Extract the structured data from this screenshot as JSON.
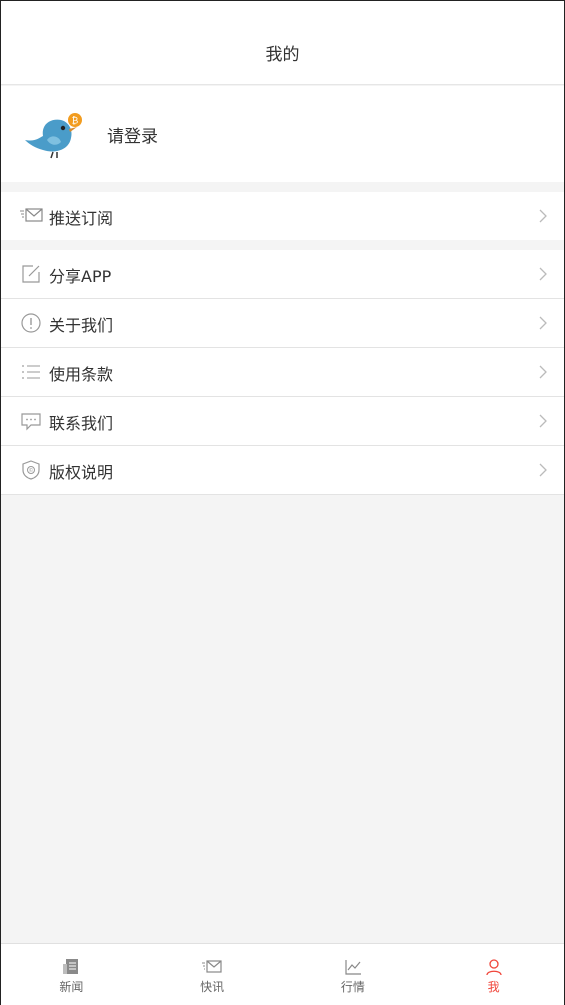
{
  "header": {
    "title": "我的"
  },
  "profile": {
    "login_label": "请登录"
  },
  "menu": {
    "push": {
      "label": "推送订阅",
      "icon": "envelope-icon"
    },
    "share": {
      "label": "分享APP",
      "icon": "share-icon"
    },
    "about": {
      "label": "关于我们",
      "icon": "info-icon"
    },
    "terms": {
      "label": "使用条款",
      "icon": "list-icon"
    },
    "contact": {
      "label": "联系我们",
      "icon": "chat-icon"
    },
    "copyright": {
      "label": "版权说明",
      "icon": "shield-icon"
    }
  },
  "tabbar": {
    "tabs": [
      {
        "label": "新闻",
        "icon": "news-icon",
        "active": false
      },
      {
        "label": "快讯",
        "icon": "envelope-icon",
        "active": false
      },
      {
        "label": "行情",
        "icon": "chart-icon",
        "active": false
      },
      {
        "label": "我",
        "icon": "person-icon",
        "active": true
      }
    ]
  },
  "colors": {
    "accent": "#f0453a",
    "bird": "#4a9cc9",
    "coin": "#f29c1f"
  }
}
